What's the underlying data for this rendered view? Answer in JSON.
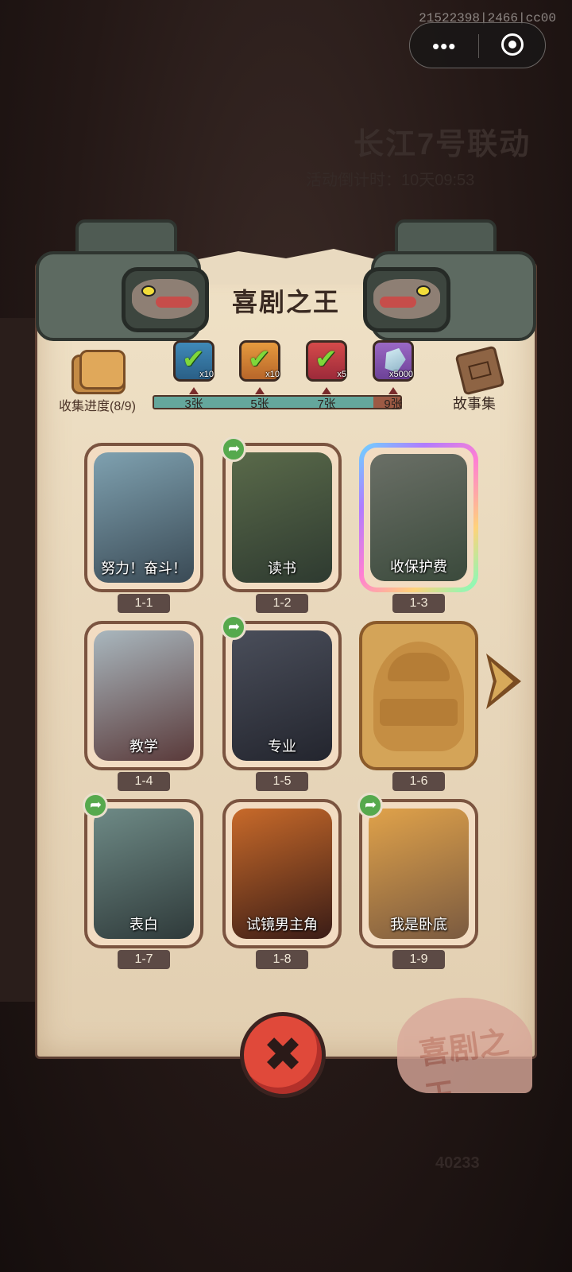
{
  "system": {
    "debug_id": "21522398|2466|cc00",
    "capsule_more_icon": "more-dots-icon",
    "capsule_close_icon": "target-icon"
  },
  "background": {
    "event_title": "长江7号联动",
    "countdown": "活动倒计时：10天09:53",
    "score": "40233"
  },
  "panel": {
    "title": "喜剧之王",
    "stamp_text": "喜剧之王",
    "collection_label": "收集进度(8/9)",
    "story_label": "故事集",
    "progress": {
      "current": 8,
      "total": 9
    },
    "milestones": [
      {
        "label": "3张",
        "reward_count": "x10",
        "claimed": true
      },
      {
        "label": "5张",
        "reward_count": "x10",
        "claimed": true
      },
      {
        "label": "7张",
        "reward_count": "x5",
        "claimed": true
      },
      {
        "label": "9张",
        "reward_count": "x5000",
        "claimed": false
      }
    ]
  },
  "cards": [
    {
      "id": "1-1",
      "caption": "努力！奋斗！",
      "shared": false,
      "locked": false,
      "rare": false,
      "colors": [
        "#7fa1b0",
        "#3a4a55"
      ]
    },
    {
      "id": "1-2",
      "caption": "读书",
      "shared": true,
      "locked": false,
      "rare": false,
      "colors": [
        "#5a6a4a",
        "#2e3a30"
      ]
    },
    {
      "id": "1-3",
      "caption": "收保护费",
      "shared": false,
      "locked": false,
      "rare": true,
      "colors": [
        "#6a6f66",
        "#3b4a3c"
      ]
    },
    {
      "id": "1-4",
      "caption": "教学",
      "shared": false,
      "locked": false,
      "rare": false,
      "colors": [
        "#a9b7be",
        "#5a3a3a"
      ]
    },
    {
      "id": "1-5",
      "caption": "专业",
      "shared": true,
      "locked": false,
      "rare": false,
      "colors": [
        "#4a4e5a",
        "#23252e"
      ]
    },
    {
      "id": "1-6",
      "caption": "",
      "shared": false,
      "locked": true,
      "rare": false,
      "colors": [
        "#d4a458",
        "#c58e43"
      ]
    },
    {
      "id": "1-7",
      "caption": "表白",
      "shared": true,
      "locked": false,
      "rare": false,
      "colors": [
        "#6e8a86",
        "#2f3a3a"
      ]
    },
    {
      "id": "1-8",
      "caption": "试镜男主角",
      "shared": false,
      "locked": false,
      "rare": false,
      "colors": [
        "#c86a2a",
        "#3a1c16"
      ]
    },
    {
      "id": "1-9",
      "caption": "我是卧底",
      "shared": true,
      "locked": false,
      "rare": false,
      "colors": [
        "#e0a24a",
        "#7a5a40"
      ]
    }
  ],
  "icons": {
    "next": "arrow-right-icon",
    "close": "close-x-icon",
    "share": "share-arrow-icon",
    "share_glyph": "➦",
    "close_glyph": "✖"
  },
  "colors": {
    "progress_fill": "#64a79c",
    "progress_empty": "#9d5a44",
    "close_button": "#e0493a",
    "share_badge": "#56a94d"
  }
}
